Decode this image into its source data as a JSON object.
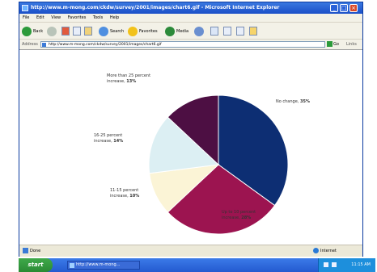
{
  "window": {
    "title": "http://www.m-mong.com/ckdw/survey/2001/images/chart6.gif - Microsoft Internet Explorer",
    "buttons": [
      "_",
      "□",
      "×"
    ]
  },
  "menu": [
    "File",
    "Edit",
    "View",
    "Favorites",
    "Tools",
    "Help"
  ],
  "toolbar": {
    "back": "Back",
    "search": "Search",
    "favorites": "Favorites",
    "media": "Media"
  },
  "address": {
    "label": "Address",
    "value": "http://www.m-mong.com/ckdw/survey/2001/images/chart6.gif",
    "go": "Go",
    "links": "Links"
  },
  "chart_data": {
    "type": "pie",
    "slices": [
      {
        "label": "No change",
        "value": 35,
        "color": "#0d2e73"
      },
      {
        "label": "Up to 10 percent increase",
        "value": 28,
        "color": "#9c1450"
      },
      {
        "label": "11-15 percent increase",
        "value": 10,
        "color": "#fbf4d6"
      },
      {
        "label": "16-25 percent increase",
        "value": 14,
        "color": "#dceff3"
      },
      {
        "label": "More than 25 percent increase",
        "value": 13,
        "color": "#4d0f43"
      }
    ],
    "labels": [
      {
        "line1": "No change,",
        "pct": "35%"
      },
      {
        "line1": "Up to 10 percent",
        "line2": "increase,",
        "pct": "28%"
      },
      {
        "line1": "11-15 percent",
        "line2": "increase,",
        "pct": "10%"
      },
      {
        "line1": "16-25 percent",
        "line2": "increase,",
        "pct": "14%"
      },
      {
        "line1": "More than 25 percent",
        "line2": "increase,",
        "pct": "13%"
      }
    ]
  },
  "status": {
    "left": "Done",
    "right": "Internet"
  },
  "taskbar": {
    "start": "start",
    "task": "http://www.m-mong...",
    "clock": "11:15 AM"
  }
}
